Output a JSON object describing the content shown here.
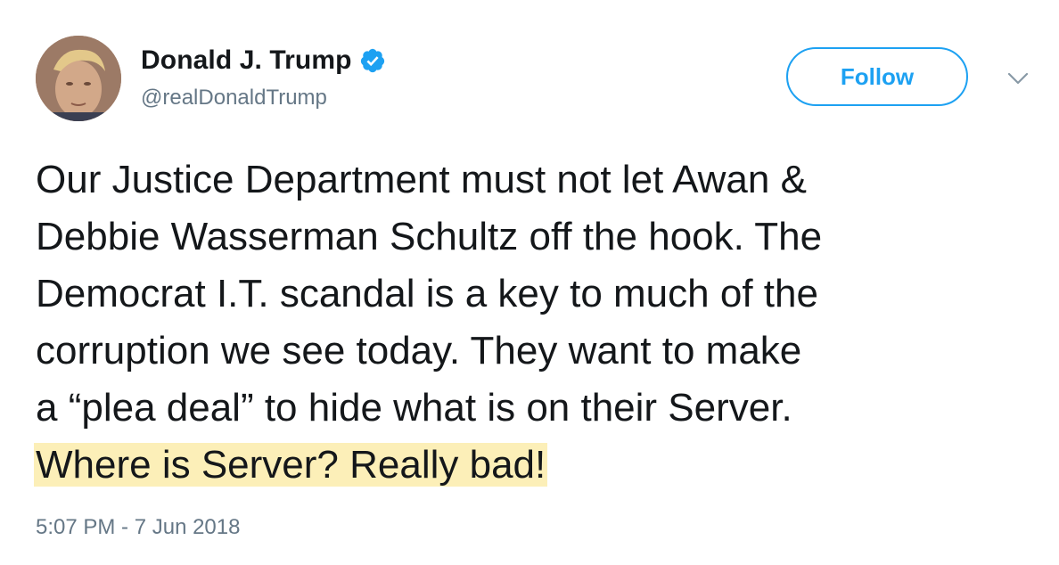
{
  "author": {
    "name": "Donald J. Trump",
    "handle": "@realDonaldTrump",
    "verified": true,
    "avatar_icon": "profile-photo"
  },
  "follow_button": {
    "label": "Follow",
    "color": "#1da1f2"
  },
  "menu_icon": "chevron-down-icon",
  "tweet": {
    "lines": [
      "Our Justice Department must not let Awan &",
      "Debbie Wasserman Schultz off the hook. The",
      "Democrat I.T. scandal is a key to much of the",
      "corruption we see today. They want to make",
      "a “plea deal” to hide what is on their Server."
    ],
    "highlighted_text": "Where is Server? Really bad!",
    "highlight_color": "#fcefb8"
  },
  "timestamp": "5:07 PM - 7 Jun 2018"
}
